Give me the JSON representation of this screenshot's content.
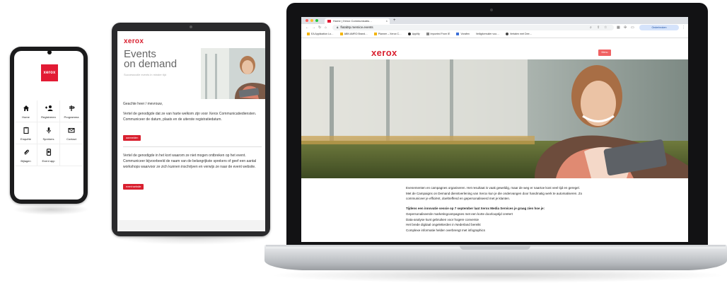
{
  "brand": {
    "name": "xerox",
    "red": "#d9202f"
  },
  "phone": {
    "logo": "xerox",
    "menu": [
      {
        "label": "Home",
        "icon": "home-icon",
        "glyph": "⌂"
      },
      {
        "label": "Registreren",
        "icon": "add-user-icon",
        "glyph": "+👤"
      },
      {
        "label": "Programma",
        "icon": "signpost-icon",
        "glyph": "┳"
      },
      {
        "label": "Enquête",
        "icon": "clipboard-icon",
        "glyph": "▯"
      },
      {
        "label": "Sprekers",
        "icon": "microphone-icon",
        "glyph": "🎙"
      },
      {
        "label": "Contact",
        "icon": "mail-icon",
        "glyph": "✉"
      },
      {
        "label": "Bijlagen",
        "icon": "paperclip-icon",
        "glyph": "📎"
      },
      {
        "label": "Event app",
        "icon": "mobile-icon",
        "glyph": "▣"
      }
    ]
  },
  "tablet": {
    "logo": "xerox",
    "heading_line1": "Events",
    "heading_line2": "on demand",
    "subheading": "Successvolle events in minder tijd",
    "greeting": "Geachte heer / mevrouw,",
    "para1": "Vertel de genodigde dat ze van harte welkom zijn voor Xerox Communicatiediensten. Communiceer de datum, plaats en de uiterste registratiedatum.",
    "button1": "aanmelden",
    "para2": "Vertel de genodigde in het kort waarom ze niet mogen ontbreken op het event. Communiceer bijvoorbeeld de naam van de belangrijkste sprekers of geef een aantal workshops waarvoor ze zich kunnen inschrijven en verwijs ze naar de event website.",
    "button2": "event website"
  },
  "laptop": {
    "tab_title": "Home | Xerox Communicatio…",
    "tab_close": "×",
    "new_tab": "+",
    "url": "flutabtp.memice.events",
    "profile": "Onderbroken",
    "bookmarks": [
      "EA Application Lo…",
      "ABN AMRO Brand…",
      "Planner – Xerox C…",
      "Applify",
      "Imported From IE",
      "Vorafen",
      "Veiligformulier voo…",
      "Vertalen met Dee…"
    ],
    "site_logo": "xerox",
    "menu_label": "Menu",
    "intro": "Evenementen en campagnes organiseren. Het resultaat is vaak geweldig, maar de weg er naartoe kost veel tijd en geregel. Met de Campaigns on Demand dienstverlening van Xerox kun je die ondervangen door handmatig werk te automatiseren. Zo communiceer je efficiënt, doeltreffend en gepersonaliseerd met je klanten.",
    "session_heading": "Tijdens een innovatie sessie op 7 september laat Xerox Media Services je graag zien hoe je:",
    "bullets": [
      "Gepersonaliseerde marketingcampagnes met een korte doorlooptijd creëert",
      "Data-analyse kunt gebruiken voor hogere conversie",
      "Het brede digitaal ongeletterden in Nederland bereikt",
      "Complexe informatie helder overbrengt met infographics"
    ]
  }
}
